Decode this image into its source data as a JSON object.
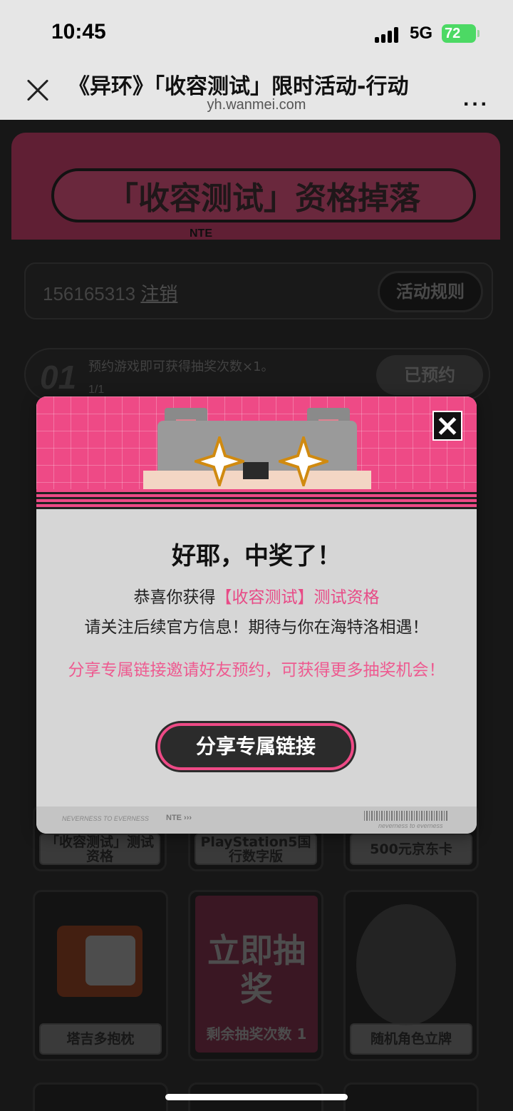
{
  "status": {
    "time": "10:45",
    "network": "5G",
    "battery": "72"
  },
  "browser": {
    "title": "《异环》「收容测试」限时活动-行动",
    "domain": "yh.wanmei.com",
    "more": "..."
  },
  "banner": {
    "title": "「收容测试」资格掉落",
    "brand": "NTE"
  },
  "account": {
    "id": "156165313",
    "logout": "注销",
    "rules_button": "活动规则"
  },
  "task1": {
    "number": "01",
    "text": "预约游戏即可获得抽奖次数×1。",
    "progress": "1/1",
    "button": "已预约"
  },
  "prizes": {
    "row1": [
      "「收容测试」测试资格",
      "PlayStation5国行数字版",
      "500元京东卡"
    ],
    "row2": [
      "塔吉多抱枕",
      "剩余抽奖次数 1",
      "随机角色立牌"
    ],
    "draw_button": "立即抽奖"
  },
  "modal": {
    "title": "好耶，中奖了！",
    "line1_prefix": "恭喜你获得",
    "line1_highlight": "【收容测试】测试资格",
    "line2": "请关注后续官方信息！期待与你在海特洛相遇！",
    "share_tip": "分享专属链接邀请好友预约，可获得更多抽奖机会！",
    "share_button": "分享专属链接",
    "footer_left": "NEVERNESS TO EVERNESS",
    "footer_mid": "NTE ›››",
    "footer_right": "neverness to everness"
  },
  "colors": {
    "accent": "#ee4a86",
    "modal_bg": "#d6d6d6",
    "page_bg": "#2a2a2a"
  }
}
